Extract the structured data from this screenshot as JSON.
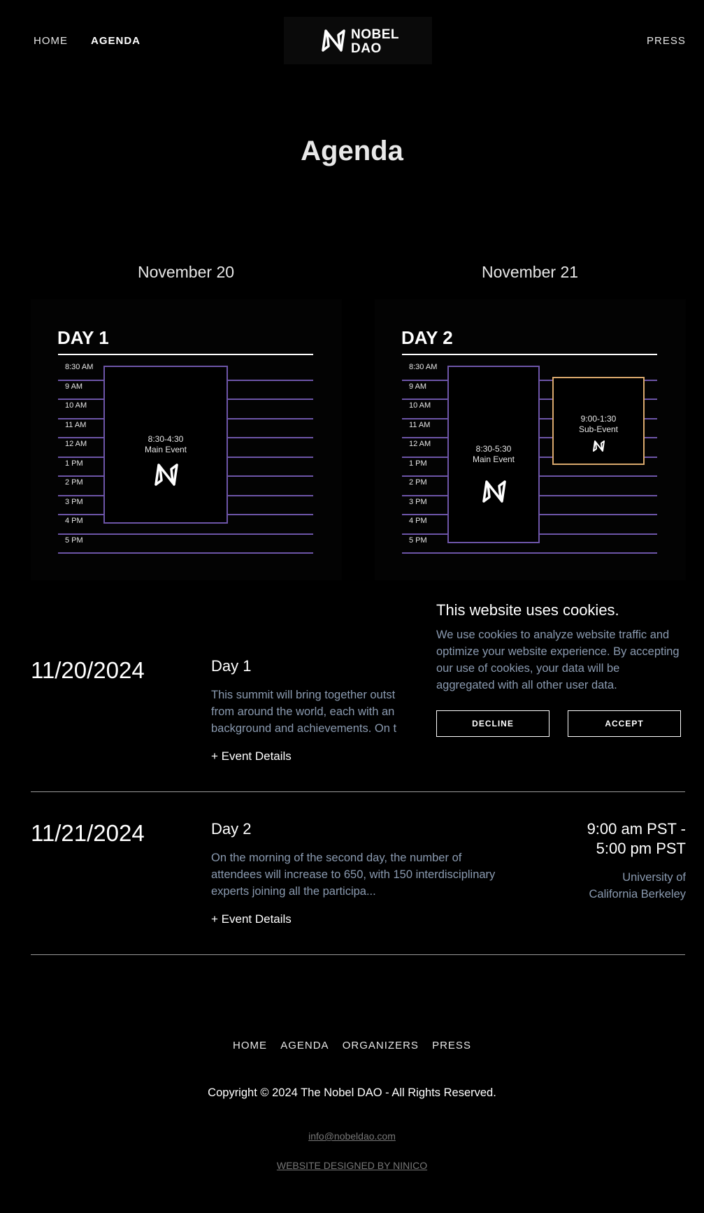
{
  "header": {
    "nav_left": [
      "HOME",
      "AGENDA"
    ],
    "nav_right": "PRESS",
    "logo_line1": "NOBEL",
    "logo_line2": "DAO",
    "active": "AGENDA"
  },
  "page_title": "Agenda",
  "days": [
    {
      "date_heading": "November 20",
      "label": "DAY 1",
      "hours": [
        "8:30 AM",
        "9 AM",
        "10 AM",
        "11 AM",
        "12 AM",
        "1 PM",
        "2 PM",
        "3 PM",
        "4 PM",
        "5 PM"
      ],
      "main_event": {
        "time": "8:30-4:30",
        "name": "Main Event"
      }
    },
    {
      "date_heading": "November 21",
      "label": "DAY 2",
      "hours": [
        "8:30 AM",
        "9 AM",
        "10 AM",
        "11 AM",
        "12 AM",
        "1 PM",
        "2 PM",
        "3 PM",
        "4 PM",
        "5 PM"
      ],
      "main_event": {
        "time": "8:30-5:30",
        "name": "Main Event"
      },
      "sub_event": {
        "time": "9:00-1:30",
        "name": "Sub-Event"
      }
    }
  ],
  "rows": [
    {
      "date": "11/20/2024",
      "title": "Day 1",
      "desc": "This summit will bring together outst from around the world, each with an background and achievements.  On t",
      "details": "+ Event Details"
    },
    {
      "date": "11/21/2024",
      "title": "Day 2",
      "desc": "On the morning of the second day, the number of attendees will increase to 650, with 150 interdisciplinary experts joining all the participa...",
      "details": "+ Event Details",
      "time_line1": "9:00 am PST -",
      "time_line2": "5:00 pm PST",
      "location_line1": "University of",
      "location_line2": "California Berkeley"
    }
  ],
  "cookie": {
    "title": "This website uses cookies.",
    "text": "We use cookies to analyze website traffic and optimize your website experience. By accepting our use of cookies, your data will be aggregated with all other user data.",
    "decline": "DECLINE",
    "accept": "ACCEPT"
  },
  "footer": {
    "nav": [
      "HOME",
      "AGENDA",
      "ORGANIZERS",
      "PRESS"
    ],
    "copyright": "Copyright © 2024 The Nobel DAO - All Rights Reserved.",
    "email": "info@nobeldao.com",
    "credit": "WEBSITE DESIGNED BY NINICO"
  },
  "colors": {
    "background": "#000000",
    "grid_line": "#6d55a8",
    "sub_event_border": "#d9a86d",
    "muted_text": "#8a9ab0"
  }
}
